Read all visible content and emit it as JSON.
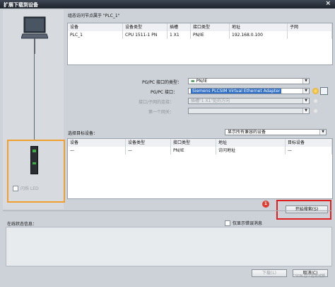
{
  "window": {
    "title": "扩展下载到设备",
    "close_glyph": "×"
  },
  "access_info": {
    "label": "组态访问节点属于 \"PLC_1\"",
    "columns": [
      "设备",
      "设备类型",
      "插槽",
      "接口类型",
      "地址",
      "子网"
    ],
    "rows": [
      [
        "PLC_1",
        "CPU 1511-1 PN",
        "1 X1",
        "PN/IE",
        "192.168.0.100",
        ""
      ]
    ]
  },
  "pgpc": {
    "type_label": "PG/PC 接口的类型：",
    "type_value": "PN/IE",
    "interface_label": "PG/PC 接口：",
    "interface_value": "Siemens PLCSIM Virtual Ethernet Adapter",
    "subnet_conn_label": "接口/子网的连接：",
    "subnet_conn_value": "插槽\"1 X1\"处的方向",
    "gateway_label": "第一个网关：",
    "gateway_value": ""
  },
  "target": {
    "label": "选择目标设备：",
    "filter_value": "显示所有兼容的设备",
    "columns": [
      "设备",
      "设备类型",
      "接口类型",
      "地址",
      "目标设备"
    ],
    "rows": [
      [
        "—",
        "—",
        "PN/IE",
        "访问地址",
        "—"
      ]
    ]
  },
  "flash_led": {
    "label": "闪烁 LED"
  },
  "search": {
    "button_label": "开始搜索(S)",
    "step": "1"
  },
  "status": {
    "label": "在线状态信息：",
    "errors_only_label": "仅显示错误消息"
  },
  "footer": {
    "download_label": "下载(L)",
    "cancel_label": "取消(C)",
    "watermark": "CSDN @工控攻城狮"
  }
}
